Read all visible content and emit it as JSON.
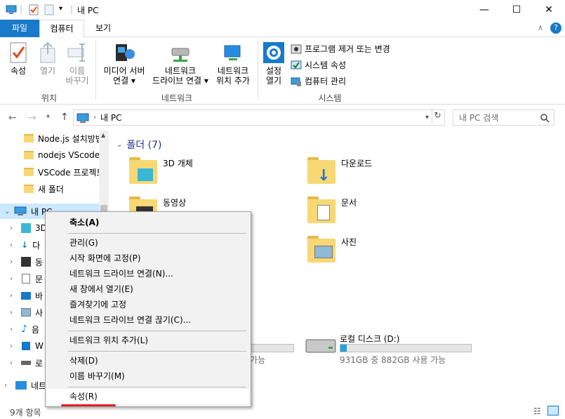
{
  "title": {
    "path": "내 PC"
  },
  "window_buttons": {
    "minimize": "—",
    "maximize": "☐",
    "close": "✕"
  },
  "tabs": {
    "file": "파일",
    "computer": "컴퓨터",
    "view": "보기"
  },
  "ribbon": {
    "properties": "속성",
    "open": "열기",
    "rename": "이름\n바꾸기",
    "group_location": "위치",
    "media_server": "미디어 서버\n연결 ▾",
    "map_drive": "네트워크\n드라이브 연결 ▾",
    "add_location": "네트워크\n위치 추가",
    "group_network": "네트워크",
    "settings": "설정\n열기",
    "uninstall": "프로그램 제거 또는 변경",
    "sys_props": "시스템 속성",
    "manage": "컴퓨터 관리",
    "group_system": "시스템"
  },
  "address": {
    "path": "내 PC",
    "search_placeholder": "내 PC 검색"
  },
  "nav": {
    "quick": [
      "Node.js 설치방법",
      "nodejs VScode",
      "VSCode 프로젝트",
      "새 폴더"
    ],
    "this_pc": "내 PC",
    "children": [
      "3D",
      "다",
      "동",
      "문",
      "바",
      "사",
      "음",
      "W",
      "로"
    ],
    "network": "네트워크"
  },
  "content": {
    "folders_header": "폴더 (7)",
    "folders": [
      "3D 개체",
      "다운로드",
      "동영상",
      "문서",
      "사진"
    ],
    "drive_c_text": "가능",
    "drive_d_name": "로컬 디스크 (D:)",
    "drive_d_space": "931GB 중 882GB 사용 가능",
    "drive_d_used": 0.05
  },
  "status": {
    "count": "9개 항목"
  },
  "context_menu": {
    "collapse": "축소(A)",
    "manage": "관리(G)",
    "pin_start": "시작 화면에 고정(P)",
    "map_drive": "네트워크 드라이브 연결(N)...",
    "open_new": "새 창에서 열기(E)",
    "pin_quick": "즐겨찾기에 고정",
    "disconnect": "네트워크 드라이브 연결 끊기(C)...",
    "add_location": "네트워크 위치 추가(L)",
    "delete": "삭제(D)",
    "rename": "이름 바꾸기(M)",
    "properties": "속성(R)"
  },
  "colors": {
    "accent": "#1979ca",
    "highlight": "#cce8ff",
    "underline": "#e0202a"
  }
}
